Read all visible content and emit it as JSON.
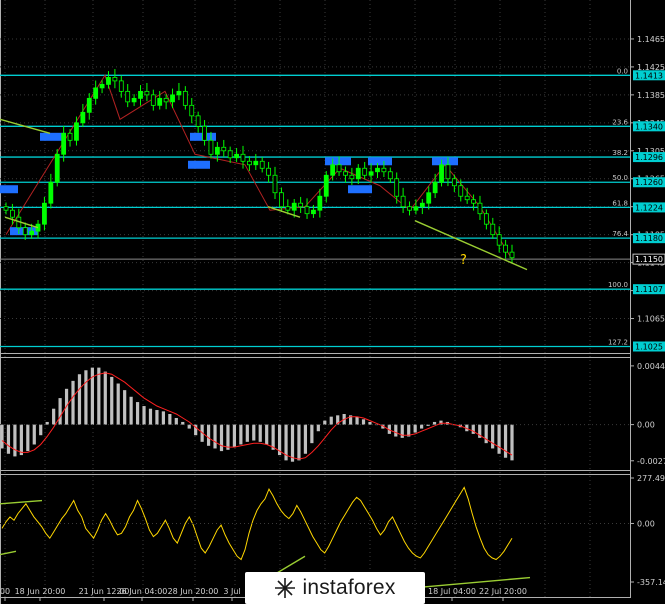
{
  "chart_data": [
    {
      "type": "candlestick",
      "price_axis": {
        "ticks": [
          "1.1465",
          "1.1425",
          "1.1385",
          "1.1345",
          "1.1305",
          "1.1265",
          "1.1225",
          "1.1185",
          "1.1145",
          "1.1105",
          "1.1065"
        ],
        "tick_values": [
          1.1465,
          1.1425,
          1.1385,
          1.1345,
          1.1305,
          1.1265,
          1.1225,
          1.1185,
          1.1145,
          1.1105,
          1.1065
        ],
        "ylim": [
          1.102,
          1.1515
        ]
      },
      "price_labels": [
        {
          "value": 1.1413,
          "text": "1.1413"
        },
        {
          "value": 1.134,
          "text": "1.1340"
        },
        {
          "value": 1.1296,
          "text": "1.1296"
        },
        {
          "value": 1.126,
          "text": "1.1260"
        },
        {
          "value": 1.1224,
          "text": "1.1224"
        },
        {
          "value": 1.118,
          "text": "1.1180"
        },
        {
          "value": 1.115,
          "text": "1.1150"
        },
        {
          "value": 1.1107,
          "text": "1.1107"
        },
        {
          "value": 1.1025,
          "text": "1.1025"
        }
      ],
      "fibonacci_levels": [
        {
          "level": "0.0",
          "value": 1.1413
        },
        {
          "level": "23.6",
          "value": 1.134
        },
        {
          "level": "38.2",
          "value": 1.1296
        },
        {
          "level": "50.0",
          "value": 1.126
        },
        {
          "level": "61.8",
          "value": 1.1224
        },
        {
          "level": "76.4",
          "value": 1.118
        },
        {
          "level": "100.0",
          "value": 1.1107
        },
        {
          "level": "127.2",
          "value": 1.1025
        }
      ],
      "current_price": 1.115,
      "annotation": "?",
      "close_series": [
        1.122,
        1.121,
        1.1195,
        1.1185,
        1.119,
        1.12,
        1.123,
        1.126,
        1.13,
        1.133,
        1.132,
        1.1345,
        1.136,
        1.138,
        1.1395,
        1.14,
        1.141,
        1.1405,
        1.139,
        1.1375,
        1.138,
        1.139,
        1.1385,
        1.137,
        1.138,
        1.1375,
        1.1385,
        1.139,
        1.137,
        1.1355,
        1.134,
        1.132,
        1.13,
        1.131,
        1.1305,
        1.1295,
        1.13,
        1.129,
        1.1285,
        1.129,
        1.128,
        1.127,
        1.1245,
        1.1225,
        1.122,
        1.123,
        1.1225,
        1.1215,
        1.122,
        1.124,
        1.127,
        1.1285,
        1.1275,
        1.127,
        1.1265,
        1.128,
        1.127,
        1.1275,
        1.128,
        1.1275,
        1.1265,
        1.124,
        1.1225,
        1.122,
        1.1225,
        1.123,
        1.1245,
        1.126,
        1.1285,
        1.1265,
        1.1255,
        1.124,
        1.1235,
        1.123,
        1.1215,
        1.12,
        1.1185,
        1.117,
        1.116,
        1.1152
      ]
    },
    {
      "type": "histogram",
      "name": "MACD",
      "ticks": [
        "0.00443",
        "0.00",
        "-0.00273"
      ],
      "tick_values": [
        0.00443,
        0.0,
        -0.00273
      ],
      "ylim": [
        -0.00335,
        0.00495
      ],
      "values": [
        -0.0018,
        -0.0022,
        -0.0024,
        -0.0023,
        -0.002,
        -0.0015,
        -0.0008,
        0.0002,
        0.0012,
        0.002,
        0.0027,
        0.0033,
        0.0038,
        0.0041,
        0.0043,
        0.0043,
        0.004,
        0.0036,
        0.0031,
        0.0026,
        0.0021,
        0.0017,
        0.0014,
        0.0012,
        0.0011,
        0.001,
        0.0008,
        0.0005,
        0.0002,
        -0.0003,
        -0.0008,
        -0.0013,
        -0.0016,
        -0.0018,
        -0.002,
        -0.0019,
        -0.0017,
        -0.0015,
        -0.0013,
        -0.0012,
        -0.0013,
        -0.0015,
        -0.0019,
        -0.0023,
        -0.0027,
        -0.0028,
        -0.0027,
        -0.0022,
        -0.0014,
        -0.0005,
        0.0003,
        0.0006,
        0.0007,
        0.0008,
        0.0007,
        0.0006,
        0.0004,
        0.0002,
        0.0,
        -0.0003,
        -0.0007,
        -0.0009,
        -0.001,
        -0.0009,
        -0.0006,
        -0.0003,
        -0.0001,
        0.0002,
        0.0003,
        0.0002,
        0.0,
        -0.0002,
        -0.0005,
        -0.0007,
        -0.001,
        -0.0014,
        -0.0018,
        -0.0022,
        -0.0025,
        -0.0027
      ],
      "signal": [
        -0.0012,
        -0.0016,
        -0.0019,
        -0.0021,
        -0.0021,
        -0.0019,
        -0.0015,
        -0.0009,
        -0.0002,
        0.0006,
        0.0014,
        0.0021,
        0.0027,
        0.0032,
        0.0036,
        0.0038,
        0.0039,
        0.0038,
        0.0035,
        0.0032,
        0.0028,
        0.0024,
        0.002,
        0.0017,
        0.0014,
        0.0012,
        0.001,
        0.0008,
        0.0005,
        0.0002,
        -0.0002,
        -0.0006,
        -0.001,
        -0.0013,
        -0.0016,
        -0.0017,
        -0.0017,
        -0.0016,
        -0.0015,
        -0.0014,
        -0.0014,
        -0.0015,
        -0.0017,
        -0.002,
        -0.0023,
        -0.0025,
        -0.0026,
        -0.0025,
        -0.0021,
        -0.0016,
        -0.001,
        -0.0004,
        0.0001,
        0.0004,
        0.0006,
        0.0006,
        0.0005,
        0.0003,
        0.0001,
        -0.0001,
        -0.0004,
        -0.0006,
        -0.0008,
        -0.0008,
        -0.0007,
        -0.0005,
        -0.0003,
        -0.0001,
        0.0001,
        0.0001,
        0.0,
        -0.0001,
        -0.0003,
        -0.0005,
        -0.0008,
        -0.0011,
        -0.0014,
        -0.0017,
        -0.002,
        -0.0023
      ]
    },
    {
      "type": "line",
      "name": "CCI",
      "ticks": [
        "277.4971",
        "0.00",
        "-357.1481"
      ],
      "tick_values": [
        277.4971,
        0.0,
        -357.1481
      ],
      "ylim": [
        -357.1481,
        277.4971
      ],
      "values": [
        -30,
        10,
        40,
        20,
        60,
        90,
        120,
        80,
        40,
        10,
        -20,
        -60,
        -90,
        -50,
        -10,
        30,
        60,
        100,
        140,
        80,
        40,
        -30,
        -60,
        -90,
        -40,
        20,
        60,
        20,
        -30,
        -70,
        -60,
        -20,
        40,
        80,
        140,
        90,
        30,
        -40,
        -80,
        -60,
        -20,
        20,
        -30,
        -90,
        -120,
        -60,
        0,
        40,
        -10,
        -80,
        -150,
        -180,
        -140,
        -90,
        -40,
        -10,
        -70,
        -120,
        -160,
        -200,
        -220,
        -160,
        -60,
        20,
        80,
        120,
        150,
        210,
        170,
        120,
        80,
        50,
        30,
        60,
        110,
        70,
        20,
        -30,
        -80,
        -120,
        -160,
        -180,
        -140,
        -90,
        -40,
        10,
        50,
        90,
        130,
        160,
        140,
        100,
        60,
        20,
        -30,
        -70,
        -40,
        10,
        40,
        -10,
        -60,
        -110,
        -150,
        -180,
        -200,
        -210,
        -180,
        -140,
        -100,
        -60,
        -20,
        20,
        60,
        100,
        140,
        180,
        220,
        150,
        60,
        -20,
        -90,
        -150,
        -190,
        -210,
        -220,
        -200,
        -170,
        -130,
        -90
      ]
    }
  ],
  "time_axis": {
    "labels": [
      "00",
      "18 Jun 20:00",
      "21 Jun 12:00",
      "26 Jun 04:00",
      "28 Jun 20:00",
      "3 Jul",
      "18 Jul 04:00",
      "22 Jul 20:00"
    ]
  },
  "colors": {
    "background": "#000000",
    "bull_candle": "#00ff00",
    "level_line": "#00ced1",
    "label_bg": "#00ced1",
    "trendline": "#9acd32",
    "macd_hist": "#c0c0c0",
    "signal_line": "#ff0000",
    "cci_line": "#ffd700",
    "support_box": "#1e6fff",
    "zigzag": "#b22222"
  },
  "watermark": {
    "text": "instaforex"
  }
}
